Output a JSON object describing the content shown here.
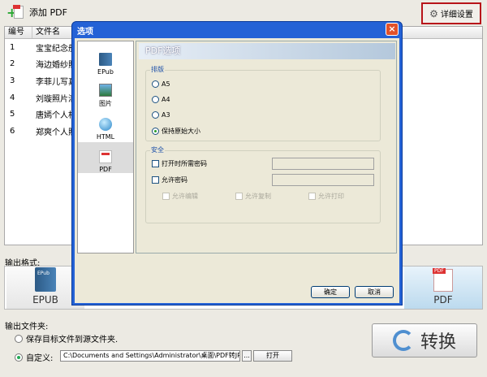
{
  "toolbar": {
    "add_label": "添加 PDF",
    "settings_label": "详细设置"
  },
  "file_list": {
    "columns": [
      "编号",
      "文件名"
    ],
    "rows": [
      {
        "no": "1",
        "name": "宝宝纪念册"
      },
      {
        "no": "2",
        "name": "海边婚纱照"
      },
      {
        "no": "3",
        "name": "李菲儿写真"
      },
      {
        "no": "4",
        "name": "刘璇照片清"
      },
      {
        "no": "5",
        "name": "唐嫣个人相"
      },
      {
        "no": "6",
        "name": "郑爽个人照"
      }
    ]
  },
  "output": {
    "format_label": "输出格式:",
    "formats": [
      {
        "label": "EPUB",
        "icon": "epub-book-icon"
      },
      {
        "label": "PDF",
        "icon": "pdf-file-icon"
      }
    ],
    "folder_label": "输出文件夹:",
    "option_source": "保存目标文件到源文件夹.",
    "option_custom": "自定义:",
    "custom_path": "C:\\Documents and Settings\\Administrator\\桌面\\PDF转JPG【www.k",
    "browse_label": "...",
    "open_label": "打开",
    "convert_label": "转换"
  },
  "dialog": {
    "title": "选项",
    "close": "×",
    "nav": [
      {
        "label": "EPub",
        "icon": "epub-icon"
      },
      {
        "label": "图片",
        "icon": "image-icon"
      },
      {
        "label": "HTML",
        "icon": "globe-icon"
      },
      {
        "label": "PDF",
        "icon": "pdf-icon",
        "active": true
      }
    ],
    "panel_title": "PDF选项",
    "layout_group": "排版",
    "layout_options": [
      "A5",
      "A4",
      "A3",
      "保持原始大小"
    ],
    "layout_selected": "保持原始大小",
    "security_group": "安全",
    "open_password": "打开时所需密码",
    "permission_password": "允许密码",
    "perms": [
      "允许编辑",
      "允许复制",
      "允许打印"
    ],
    "ok": "确定",
    "cancel": "取消"
  },
  "colors": {
    "dialog_title_bar": "#2462d6",
    "highlight_border": "#b8141a"
  }
}
